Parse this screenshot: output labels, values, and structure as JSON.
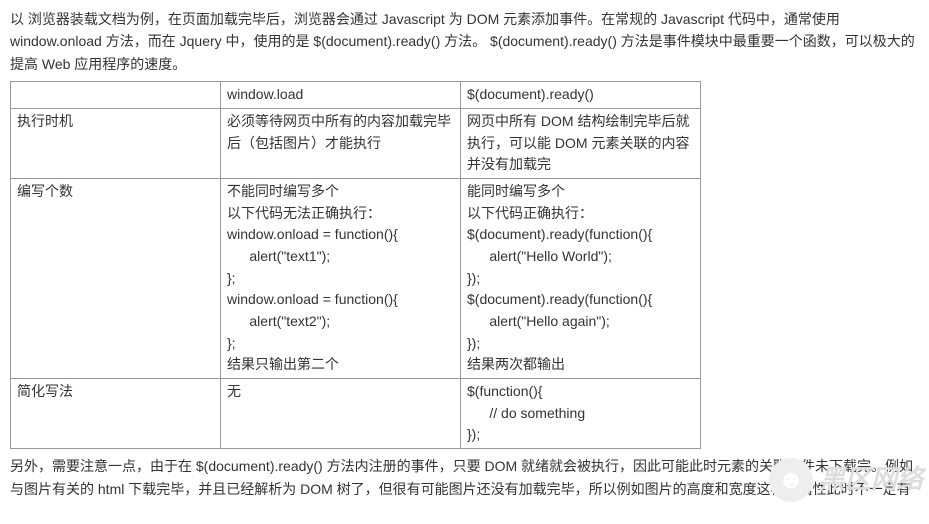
{
  "intro": "以 浏览器装载文档为例，在页面加载完毕后，浏览器会通过 Javascript 为 DOM 元素添加事件。在常规的 Javascript 代码中，通常使用 window.onload 方法，而在 Jquery 中，使用的是 $(document).ready() 方法。 $(document).ready() 方法是事件模块中最重要一个函数，可以极大的提高 Web 应用程序的速度。",
  "table": {
    "header": {
      "c1": "",
      "c2": "window.load",
      "c3": "$(document).ready()"
    },
    "rows": [
      {
        "c1": "执行时机",
        "c2": "必须等待网页中所有的内容加载完毕后（包括图片）才能执行",
        "c3": "网页中所有 DOM 结构绘制完毕后就执行，可以能 DOM 元素关联的内容并没有加载完"
      },
      {
        "c1": "编写个数",
        "c2_l1": "不能同时编写多个",
        "c2_l2": "以下代码无法正确执行：",
        "c2_l3": "window.onload = function(){",
        "c2_l4": "alert(\"text1\");",
        "c2_l5": "};",
        "c2_l6": "window.onload = function(){",
        "c2_l7": "alert(\"text2\");",
        "c2_l8": "};",
        "c2_l9": "结果只输出第二个",
        "c3_l1": "能同时编写多个",
        "c3_l2": "以下代码正确执行：",
        "c3_l3": "$(document).ready(function(){",
        "c3_l4": "alert(\"Hello World\");",
        "c3_l5": "});",
        "c3_l6": "$(document).ready(function(){",
        "c3_l7": "alert(\"Hello again\");",
        "c3_l8": "});",
        "c3_l9": "结果两次都输出"
      },
      {
        "c1": "简化写法",
        "c2": "无",
        "c3_l1": "$(function(){",
        "c3_l2": "// do something",
        "c3_l3": "});"
      }
    ]
  },
  "outro": "另外，需要注意一点，由于在 $(document).ready() 方法内注册的事件，只要 DOM 就绪就会被执行，因此可能此时元素的关联文件未下载完。例如与图片有关的 html 下载完毕，并且已经解析为 DOM 树了，但很有可能图片还没有加载完毕，所以例如图片的高度和宽度这样的属性此时不一定有",
  "watermark": "黑区网络"
}
